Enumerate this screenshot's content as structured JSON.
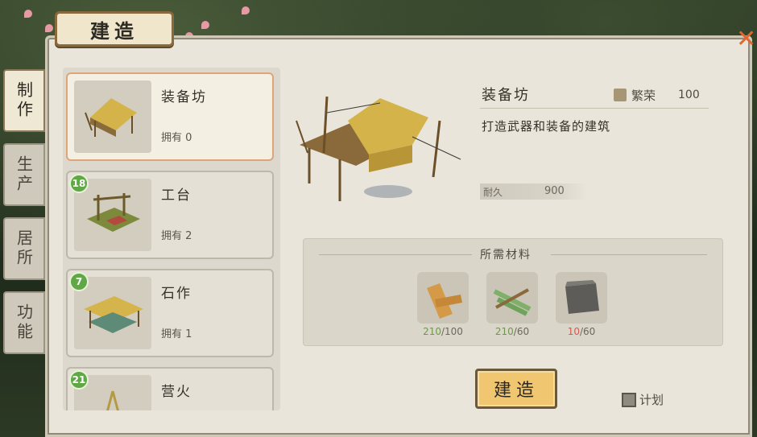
{
  "header": {
    "title": "建造"
  },
  "tabs": [
    {
      "label": "制作",
      "active": true
    },
    {
      "label": "生产",
      "active": false
    },
    {
      "label": "居所",
      "active": false
    },
    {
      "label": "功能",
      "active": false
    }
  ],
  "buildings": [
    {
      "name": "装备坊",
      "owned": "拥有 0",
      "badge": "",
      "selected": true
    },
    {
      "name": "工台",
      "owned": "拥有 2",
      "badge": "18",
      "selected": false
    },
    {
      "name": "石作",
      "owned": "拥有 1",
      "badge": "7",
      "selected": false
    },
    {
      "name": "营火",
      "owned": "",
      "badge": "21",
      "selected": false
    }
  ],
  "detail": {
    "name": "装备坊",
    "prosperity_label": "繁荣",
    "prosperity_value": "100",
    "description": "打造武器和装备的建筑",
    "durability_label": "耐久",
    "durability_value": "900"
  },
  "materials": {
    "title": "所需材料",
    "items": [
      {
        "icon": "wood-plank-icon",
        "have": "210",
        "need": "/100",
        "status": "ok"
      },
      {
        "icon": "bamboo-icon",
        "have": "210",
        "need": "/60",
        "status": "ok"
      },
      {
        "icon": "stone-block-icon",
        "have": "10",
        "need": "/60",
        "status": "bad"
      }
    ]
  },
  "actions": {
    "build_label": "建造",
    "plan_label": "计划"
  },
  "colors": {
    "accent": "#f1c670",
    "ok": "#6c9a49",
    "insufficient": "#d45b4f",
    "badge": "#5fa845"
  }
}
